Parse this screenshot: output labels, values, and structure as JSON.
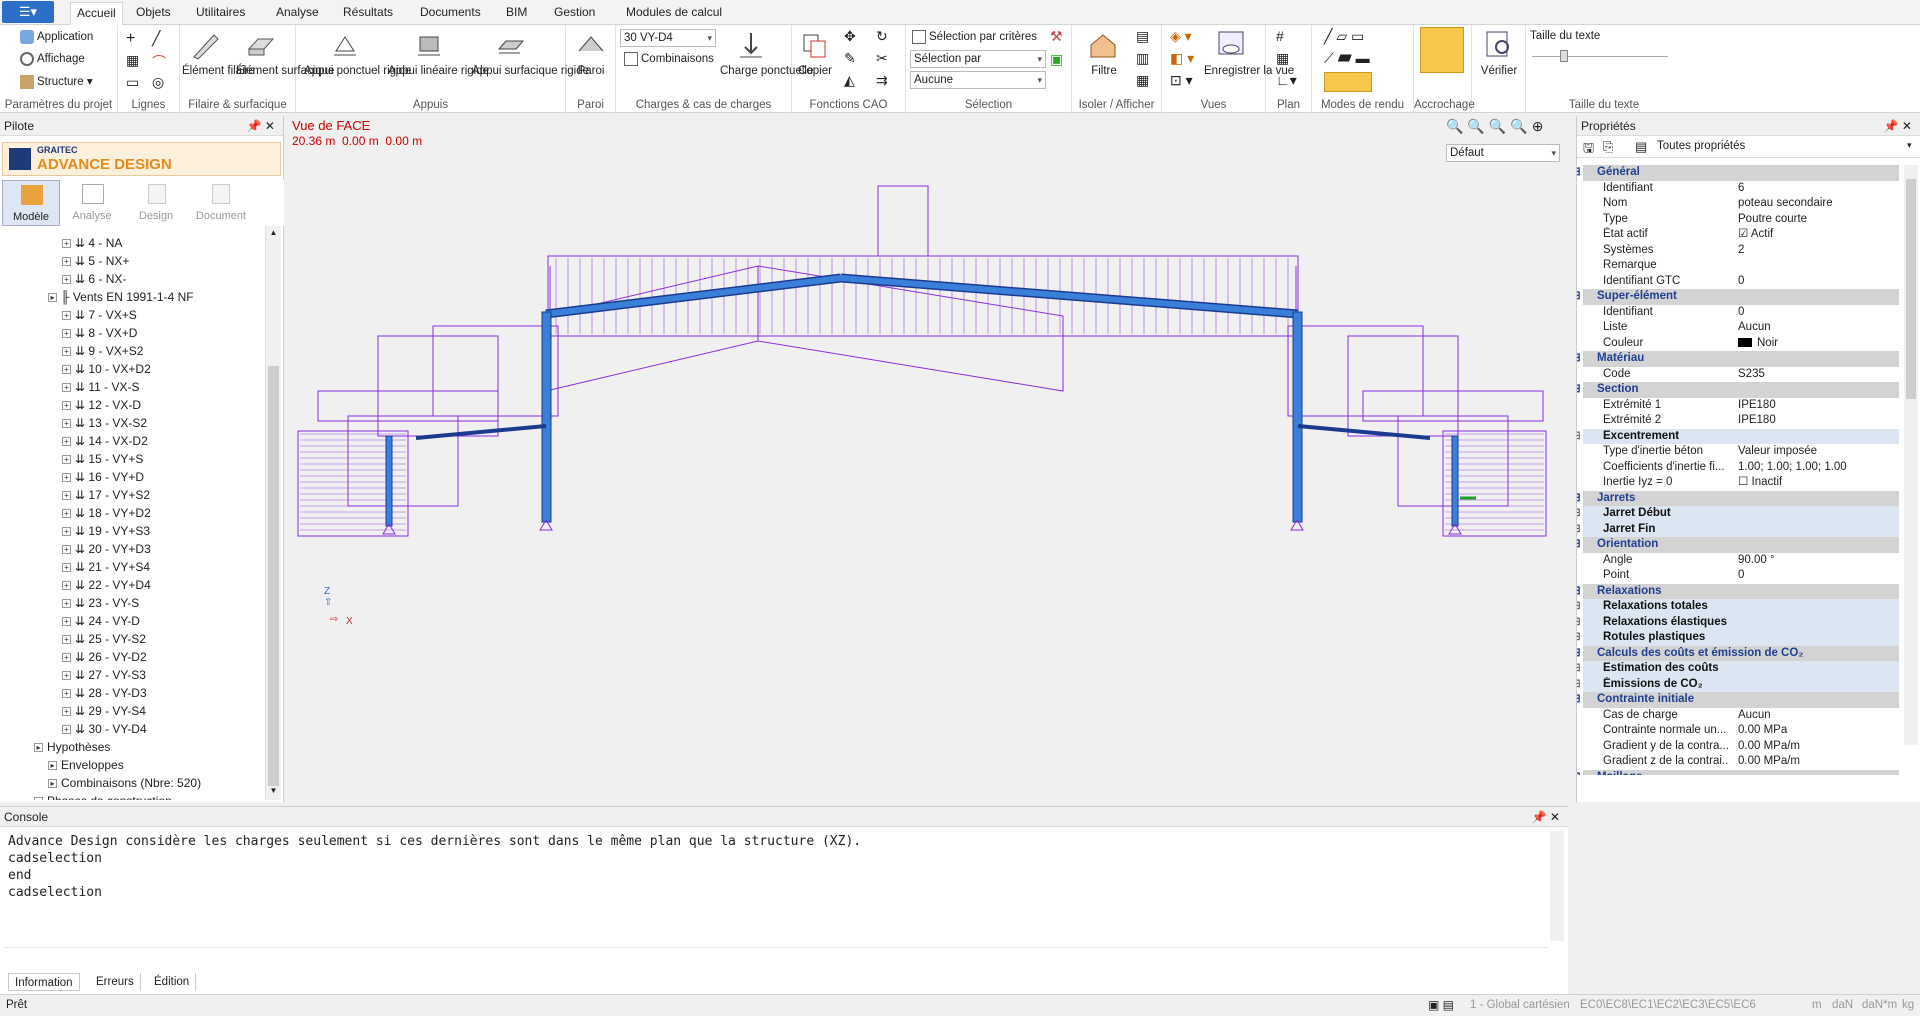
{
  "tabs": [
    "Accueil",
    "Objets",
    "Utilitaires",
    "Analyse",
    "Résultats",
    "Documents",
    "BIM",
    "Gestion",
    "Modules de calcul"
  ],
  "ribbon": {
    "groups": [
      "Paramètres du projet",
      "Lignes",
      "Filaire & surfacique",
      "Appuis",
      "Paroi",
      "Charges & cas de charges",
      "Fonctions CAO",
      "Sélection",
      "Isoler / Afficher",
      "Vues",
      "Plan",
      "Modes de rendu",
      "Accrochage",
      "",
      "Taille du texte"
    ],
    "project": [
      "Application",
      "Affichage",
      "Structure"
    ],
    "element_filaire": "Élément filaire",
    "element_surfacique": "Élément surfacique",
    "appui_ponctuel": "Appui ponctuel rigide",
    "appui_lineaire": "Appui linéaire rigide",
    "appui_surfacique": "Appui surfacique rigide",
    "paroi": "Paroi",
    "loadcase_combo": "30 VY-D4",
    "combinaisons": "Combinaisons",
    "charge_ponctuelle": "Charge ponctuelle",
    "copier": "Copier",
    "selection_criteres": "Sélection par critères",
    "selection_par": "Sélection par",
    "aucune": "Aucune",
    "filtre": "Filtre",
    "enregistrer_vue": "Enregistrer la vue",
    "verifier": "Vérifier",
    "taille_texte": "Taille du texte"
  },
  "pilot": {
    "title": "Pilote",
    "logo_brand": "GRAITEC",
    "logo_product": "ADVANCE DESIGN",
    "modes": [
      "Modèle",
      "Analyse",
      "Design",
      "Document"
    ],
    "tree": [
      {
        "label": "4 - NA",
        "indent": 3
      },
      {
        "label": "5 - NX+",
        "indent": 3
      },
      {
        "label": "6 - NX-",
        "indent": 3
      },
      {
        "label": "Vents EN 1991-1-4 NF",
        "indent": 2
      },
      {
        "label": "7 - VX+S",
        "indent": 3
      },
      {
        "label": "8 - VX+D",
        "indent": 3
      },
      {
        "label": "9 - VX+S2",
        "indent": 3
      },
      {
        "label": "10 - VX+D2",
        "indent": 3
      },
      {
        "label": "11 - VX-S",
        "indent": 3
      },
      {
        "label": "12 - VX-D",
        "indent": 3
      },
      {
        "label": "13 - VX-S2",
        "indent": 3
      },
      {
        "label": "14 - VX-D2",
        "indent": 3
      },
      {
        "label": "15 - VY+S",
        "indent": 3
      },
      {
        "label": "16 - VY+D",
        "indent": 3
      },
      {
        "label": "17 - VY+S2",
        "indent": 3
      },
      {
        "label": "18 - VY+D2",
        "indent": 3
      },
      {
        "label": "19 - VY+S3",
        "indent": 3
      },
      {
        "label": "20 - VY+D3",
        "indent": 3
      },
      {
        "label": "21 - VY+S4",
        "indent": 3
      },
      {
        "label": "22 - VY+D4",
        "indent": 3
      },
      {
        "label": "23 - VY-S",
        "indent": 3
      },
      {
        "label": "24 - VY-D",
        "indent": 3
      },
      {
        "label": "25 - VY-S2",
        "indent": 3
      },
      {
        "label": "26 - VY-D2",
        "indent": 3
      },
      {
        "label": "27 - VY-S3",
        "indent": 3
      },
      {
        "label": "28 - VY-D3",
        "indent": 3
      },
      {
        "label": "29 - VY-S4",
        "indent": 3
      },
      {
        "label": "30 - VY-D4",
        "indent": 3
      },
      {
        "label": "Hypothèses",
        "indent": 1
      },
      {
        "label": "Enveloppes",
        "indent": 2
      },
      {
        "label": "Combinaisons (Nbre: 520)",
        "indent": 2
      },
      {
        "label": "Phases de construction",
        "indent": 1
      }
    ]
  },
  "viewport": {
    "view_name": "Vue de FACE",
    "coords": "20.36 m  0.00 m  0.00 m",
    "view_combo": "Défaut",
    "axis_z": "Z",
    "axis_x": "X"
  },
  "props": {
    "title": "Propriétés",
    "filter": "Toutes propriétés",
    "rows": [
      {
        "t": "sec",
        "k": "Général"
      },
      {
        "k": "Identifiant",
        "v": "6"
      },
      {
        "k": "Nom",
        "v": "poteau secondaire"
      },
      {
        "k": "Type",
        "v": "Poutre courte"
      },
      {
        "k": "État actif",
        "v": "Actif",
        "chk": true
      },
      {
        "k": "Systèmes",
        "v": "2"
      },
      {
        "k": "Remarque",
        "v": ""
      },
      {
        "k": "Identifiant GTC",
        "v": "0"
      },
      {
        "t": "sec",
        "k": "Super-élément"
      },
      {
        "k": "Identifiant",
        "v": "0"
      },
      {
        "k": "Liste",
        "v": "Aucun"
      },
      {
        "k": "Couleur",
        "v": "Noir",
        "swatch": "#000000"
      },
      {
        "t": "sec",
        "k": "Matériau"
      },
      {
        "k": "Code",
        "v": "S235"
      },
      {
        "t": "sec",
        "k": "Section"
      },
      {
        "k": "Extrémité 1",
        "v": "IPE180"
      },
      {
        "k": "Extrémité 2",
        "v": "IPE180"
      },
      {
        "t": "sub",
        "k": "Excentrement"
      },
      {
        "k": "Type d'inertie béton",
        "v": "Valeur imposée"
      },
      {
        "k": "Coefficients d'inertie fi...",
        "v": "1.00; 1.00; 1.00; 1.00"
      },
      {
        "k": "Inertie Iyz = 0",
        "v": "Inactif",
        "chk": false
      },
      {
        "t": "sec",
        "k": "Jarrets"
      },
      {
        "t": "sub",
        "k": "Jarret Début"
      },
      {
        "t": "sub",
        "k": "Jarret Fin"
      },
      {
        "t": "sec",
        "k": "Orientation"
      },
      {
        "k": "Angle",
        "v": "90.00 °"
      },
      {
        "k": "Point",
        "v": "0"
      },
      {
        "t": "sec",
        "k": "Relaxations"
      },
      {
        "t": "sub",
        "k": "Relaxations totales"
      },
      {
        "t": "sub",
        "k": "Relaxations élastiques"
      },
      {
        "t": "sub",
        "k": "Rotules plastiques"
      },
      {
        "t": "sec",
        "k": "Calculs des coûts et émission de CO₂"
      },
      {
        "t": "sub",
        "k": "Estimation des coûts"
      },
      {
        "t": "sub",
        "k": "Émissions de CO₂"
      },
      {
        "t": "sec",
        "k": "Contrainte initiale"
      },
      {
        "k": "Cas de charge",
        "v": "Aucun"
      },
      {
        "k": "Contrainte normale un...",
        "v": "0.00 MPa"
      },
      {
        "k": "Gradient y de la contra...",
        "v": "0.00 MPa/m"
      },
      {
        "k": "Gradient z de la contrai...",
        "v": "0.00 MPa/m"
      },
      {
        "t": "sec",
        "k": "Maillage"
      }
    ]
  },
  "console": {
    "title": "Console",
    "lines": [
      "Advance Design considère les charges seulement si ces dernières sont dans le même plan que la structure (XZ).",
      "cadselection",
      "end",
      "cadselection"
    ],
    "tabs": [
      "Information",
      "Erreurs",
      "Édition"
    ]
  },
  "status": {
    "left": "Prêt",
    "coord_system": "1 - Global cartésien",
    "codes": "EC0\\EC8\\EC1\\EC2\\EC3\\EC5\\EC6",
    "units": [
      "m",
      "daN",
      "daN*m",
      "kg"
    ]
  },
  "colors": {
    "accent": "#2b6fc7",
    "load": "#8a2be2",
    "member": "#3a7fd9",
    "section_header": "#1f3f8f"
  }
}
